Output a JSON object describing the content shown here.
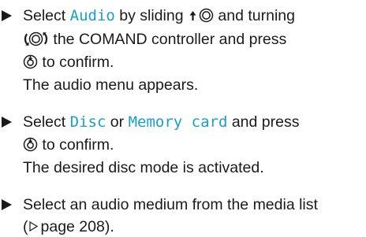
{
  "steps": [
    {
      "lines": [
        {
          "pre": "Select ",
          "highlight": "Audio",
          "mid": " by sliding ",
          "icons": [
            "slide-up-icon",
            "controller-ring-icon"
          ],
          "post": " and turning"
        },
        {
          "icons": [
            "turn-controller-icon"
          ],
          "text": " the COMAND controller and press"
        },
        {
          "icons": [
            "press-controller-icon"
          ],
          "text": " to confirm."
        },
        {
          "text": "The audio menu appears."
        }
      ]
    },
    {
      "lines": [
        {
          "pre": "Select ",
          "highlight1": "Disc",
          "mid": " or ",
          "highlight2": "Memory card",
          "post": " and press"
        },
        {
          "icons": [
            "press-controller-icon"
          ],
          "text": " to confirm."
        },
        {
          "text": "The desired disc mode is activated."
        }
      ]
    },
    {
      "lines": [
        {
          "text": "Select an audio medium from the media list"
        },
        {
          "ref_icon": "page-reference-triangle-icon",
          "ref_text": "page 208",
          "open": "(",
          "close": ")."
        }
      ]
    }
  ],
  "colors": {
    "text": "#1a1a1a",
    "highlight": "#1aa0c8"
  }
}
